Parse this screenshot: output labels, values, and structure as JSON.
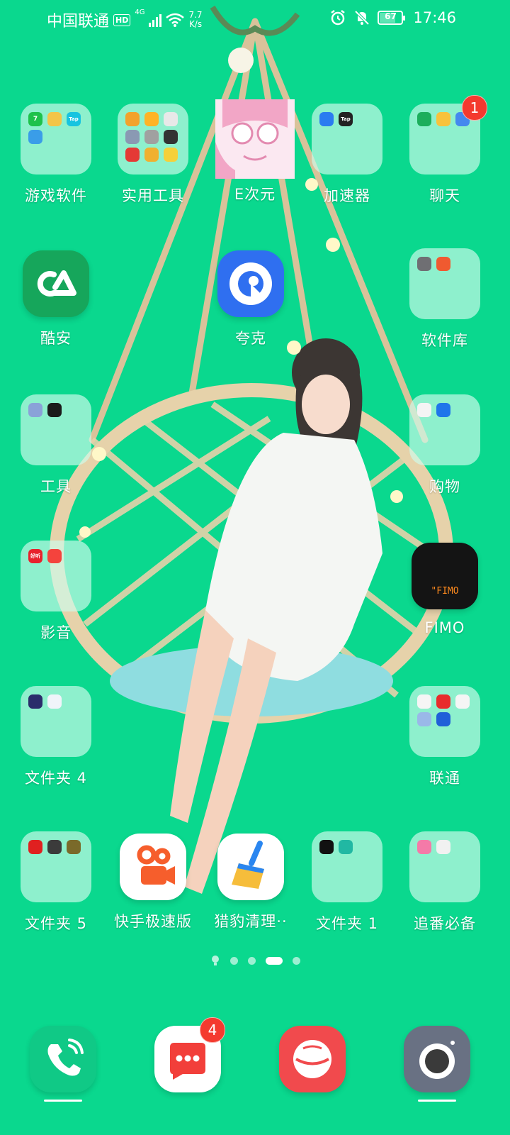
{
  "status_bar": {
    "carrier": "中国联通",
    "network_badge": "HD",
    "network_type": "4G",
    "speed_value": "7.7",
    "speed_unit": "K/s",
    "battery_level": "67",
    "time": "17:46"
  },
  "apps": [
    {
      "label": "游戏软件",
      "type": "folder"
    },
    {
      "label": "实用工具",
      "type": "folder"
    },
    {
      "label": "E次元",
      "type": "app"
    },
    {
      "label": "加速器",
      "type": "folder"
    },
    {
      "label": "聊天",
      "type": "folder",
      "badge": "1"
    },
    {
      "label": "酷安",
      "type": "app"
    },
    {
      "label": "夸克",
      "type": "app"
    },
    {
      "label": "软件库",
      "type": "folder"
    },
    {
      "label": "工具",
      "type": "folder"
    },
    {
      "label": "购物",
      "type": "folder"
    },
    {
      "label": "影音",
      "type": "folder"
    },
    {
      "label": "FIMO",
      "type": "app",
      "icon_text": "\"FIMO"
    },
    {
      "label": "文件夹 4",
      "type": "folder"
    },
    {
      "label": "联通",
      "type": "folder"
    },
    {
      "label": "文件夹 5",
      "type": "folder"
    },
    {
      "label": "快手极速版",
      "type": "app"
    },
    {
      "label": "猎豹清理··",
      "type": "app"
    },
    {
      "label": "文件夹 1",
      "type": "folder"
    },
    {
      "label": "追番必备",
      "type": "folder"
    }
  ],
  "mini_icon_text": {
    "taptap": "Tap",
    "hub": "Tap",
    "music": "好听"
  },
  "page_indicator": {
    "pages": 5,
    "current": 4
  },
  "dock": [
    {
      "name": "phone",
      "badge": null
    },
    {
      "name": "messages",
      "badge": "4"
    },
    {
      "name": "browser",
      "badge": null
    },
    {
      "name": "camera",
      "badge": null
    }
  ],
  "colors": {
    "background": "#0ad88e",
    "badge": "#f43a2f"
  }
}
